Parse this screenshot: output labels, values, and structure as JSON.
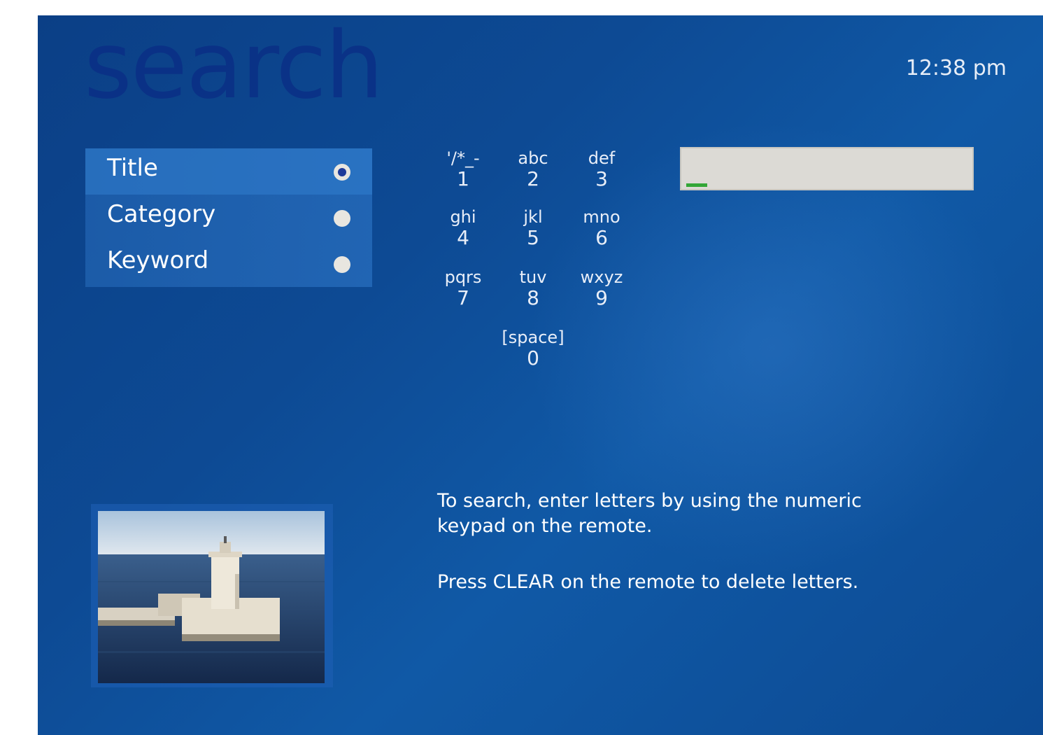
{
  "header": {
    "title": "search",
    "time": "12:38 pm"
  },
  "search_by": {
    "options": [
      {
        "label": "Title",
        "selected": true
      },
      {
        "label": "Category",
        "selected": false
      },
      {
        "label": "Keyword",
        "selected": false
      }
    ]
  },
  "keypad": {
    "keys": [
      {
        "letters": "'/*_-",
        "digit": "1"
      },
      {
        "letters": "abc",
        "digit": "2"
      },
      {
        "letters": "def",
        "digit": "3"
      },
      {
        "letters": "ghi",
        "digit": "4"
      },
      {
        "letters": "jkl",
        "digit": "5"
      },
      {
        "letters": "mno",
        "digit": "6"
      },
      {
        "letters": "pqrs",
        "digit": "7"
      },
      {
        "letters": "tuv",
        "digit": "8"
      },
      {
        "letters": "wxyz",
        "digit": "9"
      },
      {
        "letters": "[space]",
        "digit": "0"
      }
    ]
  },
  "search_field": {
    "value": ""
  },
  "instructions": {
    "line1": "To search, enter letters by using the numeric keypad on the remote.",
    "line2": "Press CLEAR on the remote to delete letters."
  },
  "colors": {
    "background": "#0d4a94",
    "title": "#0a2f86",
    "cursor": "#33a637"
  }
}
